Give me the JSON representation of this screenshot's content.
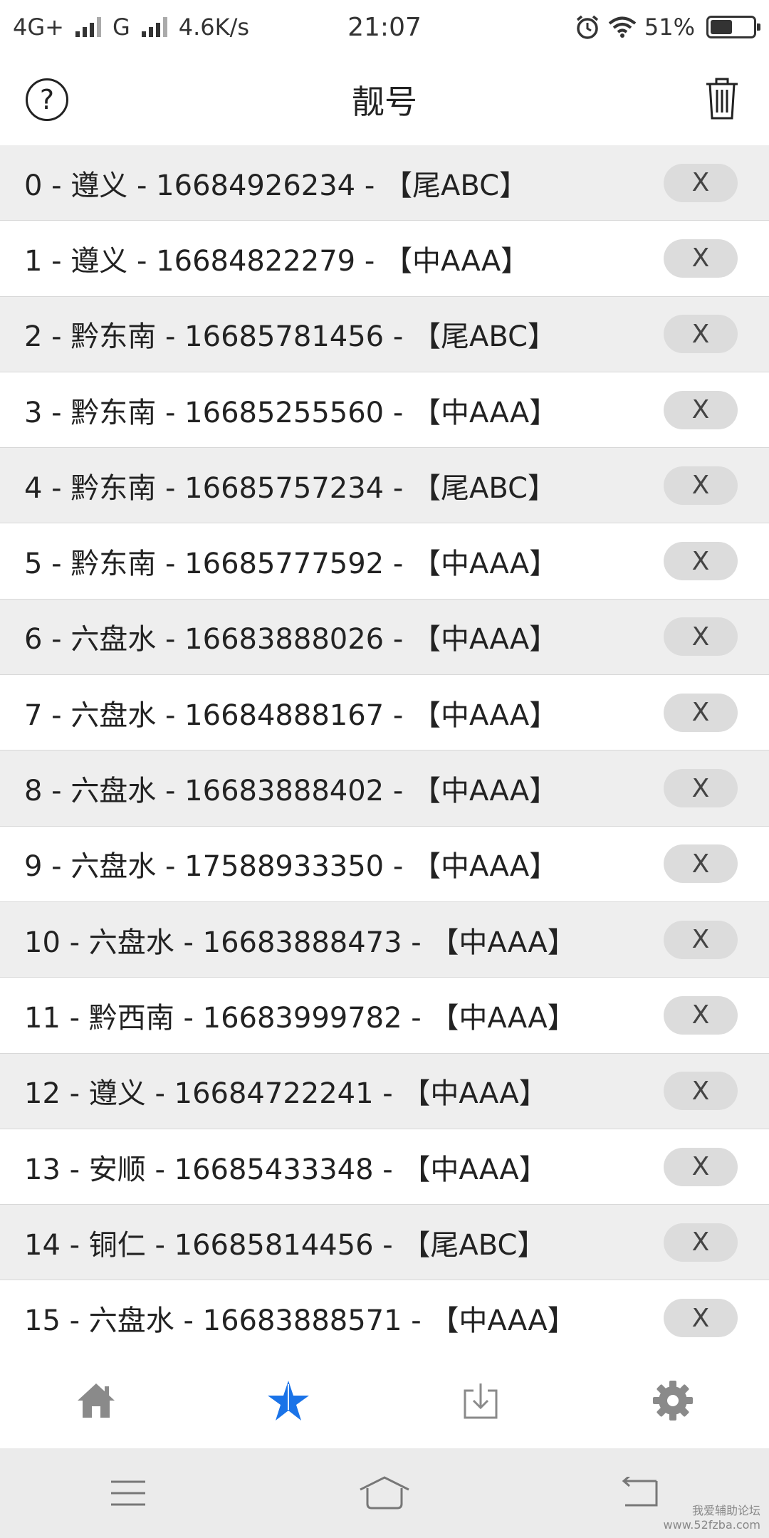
{
  "status_bar": {
    "network": "4G+",
    "network2": "G",
    "speed": "4.6K/s",
    "time": "21:07",
    "battery": "51%",
    "battery_level": 0.51,
    "icons": [
      "signal-icon",
      "alarm-icon",
      "wifi-icon",
      "battery-icon"
    ]
  },
  "header": {
    "title": "靓号",
    "help_label": "?",
    "icons": [
      "help-icon",
      "trash-icon"
    ]
  },
  "list": {
    "delete_label": "X",
    "items": [
      "0 - 遵义 - 16684926234 - 【尾ABC】",
      "1 - 遵义 - 16684822279 - 【中AAA】",
      "2 - 黔东南 - 16685781456 - 【尾ABC】",
      "3 - 黔东南 - 16685255560 - 【中AAA】",
      "4 - 黔东南 - 16685757234 - 【尾ABC】",
      "5 - 黔东南 - 16685777592 - 【中AAA】",
      "6 - 六盘水 - 16683888026 - 【中AAA】",
      "7 - 六盘水 - 16684888167 - 【中AAA】",
      "8 - 六盘水 - 16683888402 - 【中AAA】",
      "9 - 六盘水 - 17588933350 - 【中AAA】",
      "10 - 六盘水 - 16683888473 - 【中AAA】",
      "11 - 黔西南 - 16683999782 - 【中AAA】",
      "12 - 遵义 - 16684722241 - 【中AAA】",
      "13 - 安顺 - 16685433348 - 【中AAA】",
      "14 - 铜仁 - 16685814456 - 【尾ABC】",
      "15 - 六盘水 - 16683888571 - 【中AAA】"
    ]
  },
  "tab_bar": {
    "active_index": 1,
    "active_color": "#1a73e8",
    "inactive_color": "#8a8a8a",
    "icons": [
      "home-icon",
      "star-icon",
      "download-icon",
      "gear-icon"
    ]
  },
  "nav_bar": {
    "icons": [
      "menu-icon",
      "home-outline-icon",
      "back-icon"
    ]
  },
  "watermark": {
    "line1": "我爱辅助论坛",
    "line2": "www.52fzba.com"
  }
}
